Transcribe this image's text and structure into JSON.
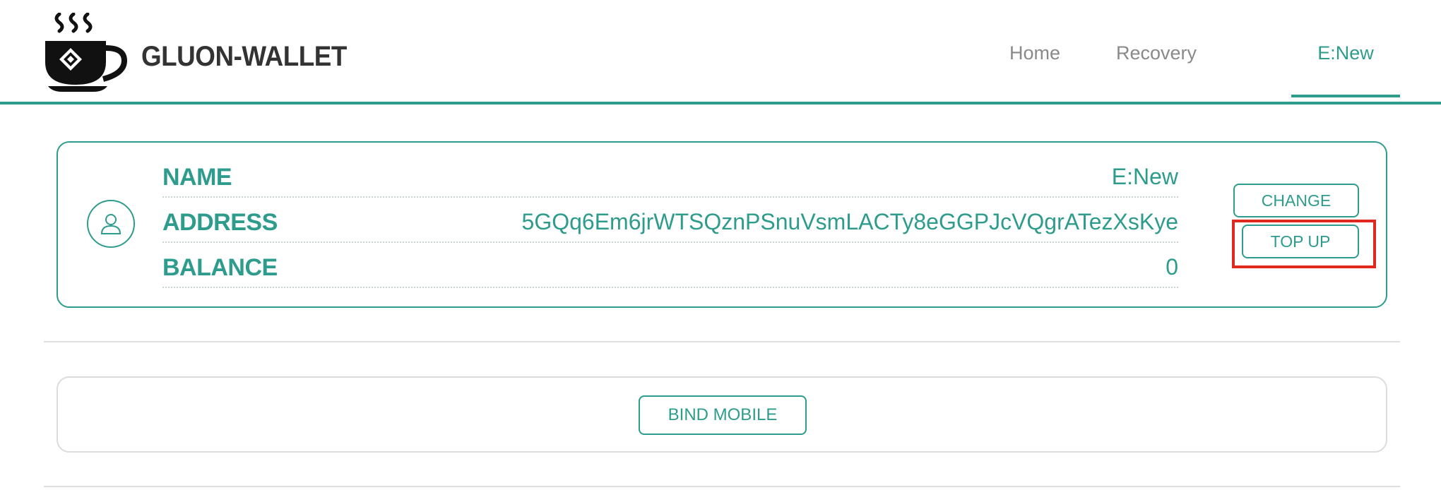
{
  "header": {
    "brand": "GLUON-WALLET",
    "logo_icon": "coffee-cup-logo-icon",
    "nav": {
      "home": "Home",
      "recovery": "Recovery",
      "active": "E:New"
    }
  },
  "account": {
    "avatar_icon": "user-icon",
    "fields": {
      "name_label": "NAME",
      "name_value": "E:New",
      "address_label": "ADDRESS",
      "address_value": "5GQq6Em6jrWTSQznPSnuVsmLACTy8eGGPJcVQgrATezXsKye",
      "balance_label": "BALANCE",
      "balance_value": "0"
    },
    "buttons": {
      "change": "CHANGE",
      "top_up": "TOP UP"
    }
  },
  "bind": {
    "button": "BIND MOBILE"
  },
  "colors": {
    "accent": "#2e9c8c",
    "highlight": "#e0281e"
  }
}
